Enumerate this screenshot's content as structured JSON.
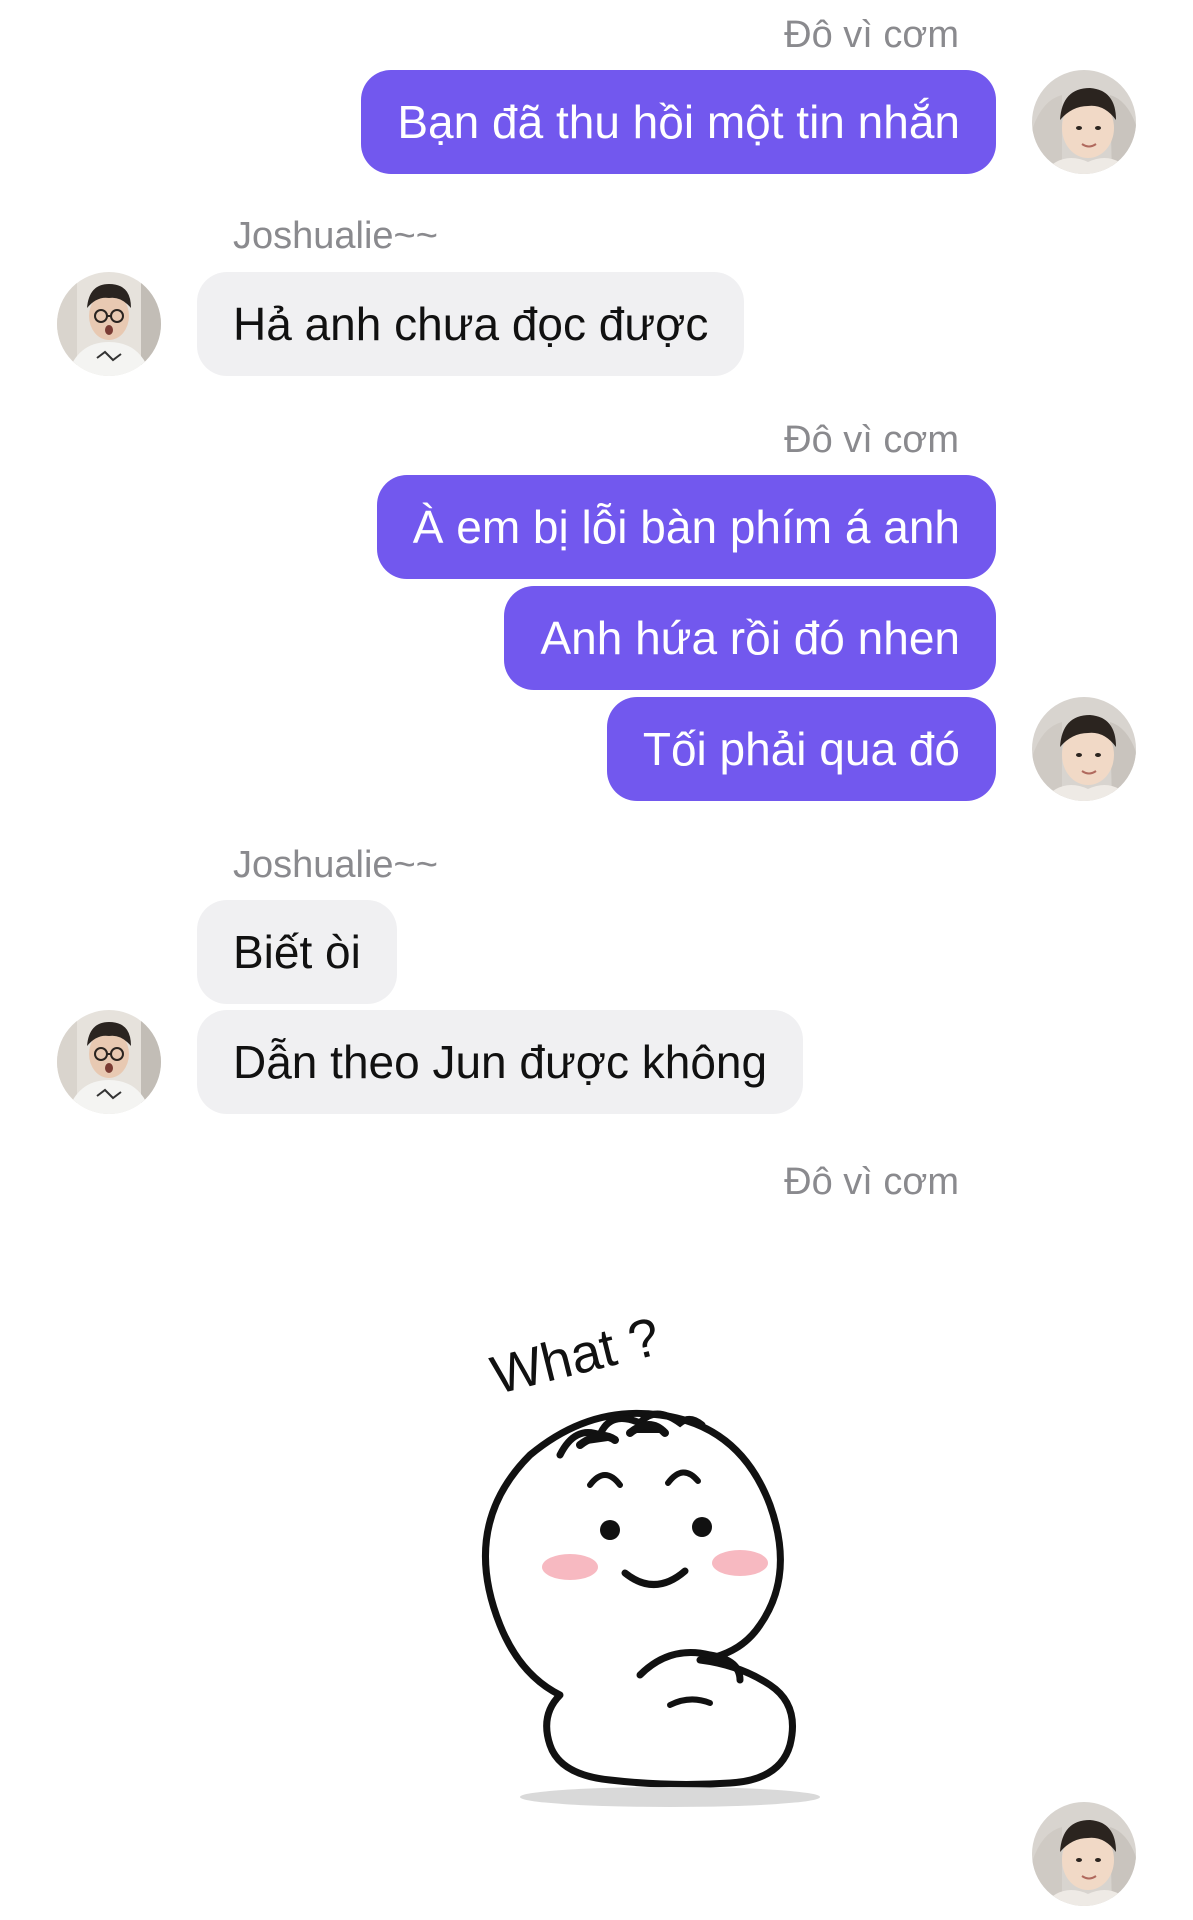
{
  "conversation": {
    "me_name": "Đô vì cơm",
    "other_name": "Joshualie~~",
    "messages": [
      {
        "text": "Bạn đã thu hồi một tin nhắn"
      },
      {
        "text": "Hả anh chưa đọc được"
      },
      {
        "text": "À em bị lỗi bàn phím á anh"
      },
      {
        "text": "Anh hứa rồi đó nhen"
      },
      {
        "text": "Tối phải qua đó"
      },
      {
        "text": "Biết òi"
      },
      {
        "text": "Dẫn theo Jun được không"
      }
    ],
    "sticker": {
      "caption": "What ?"
    }
  },
  "colors": {
    "outgoing_bubble": "#7258ee",
    "incoming_bubble": "#f0f0f2",
    "sender_name": "#8a8a8e"
  }
}
